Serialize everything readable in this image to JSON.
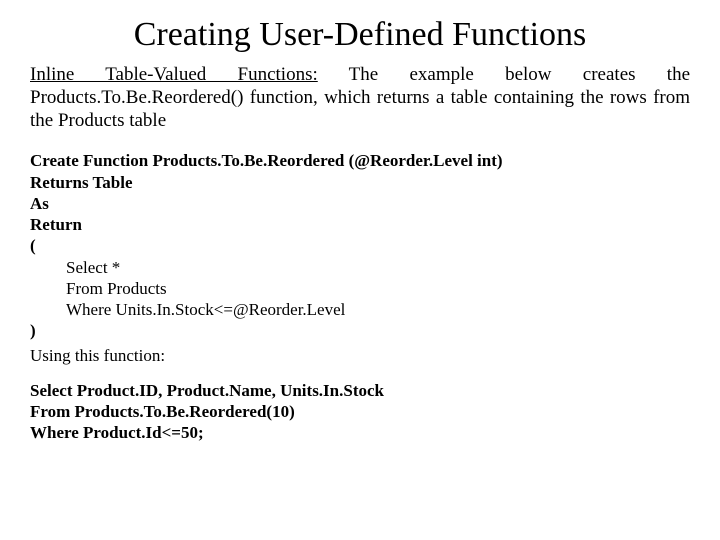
{
  "title": "Creating User-Defined Functions",
  "intro": {
    "heading": "Inline Table-Valued Functions:",
    "rest": " The example below creates the Products.To.Be.Reordered() function, which returns a table containing the rows from the Products table"
  },
  "code": {
    "l1": "Create Function Products.To.Be.Reordered (@Reorder.Level int)",
    "l2": "Returns Table",
    "l3": "As",
    "l4": "Return",
    "l5": "(",
    "l6": "Select *",
    "l7": "From Products",
    "l8": "Where Units.In.Stock<=@Reorder.Level",
    "l9": ")"
  },
  "using_label": "Using this function:",
  "query": {
    "l1": "Select Product.ID, Product.Name, Units.In.Stock",
    "l2": "From Products.To.Be.Reordered(10)",
    "l3": "Where Product.Id<=50;"
  }
}
